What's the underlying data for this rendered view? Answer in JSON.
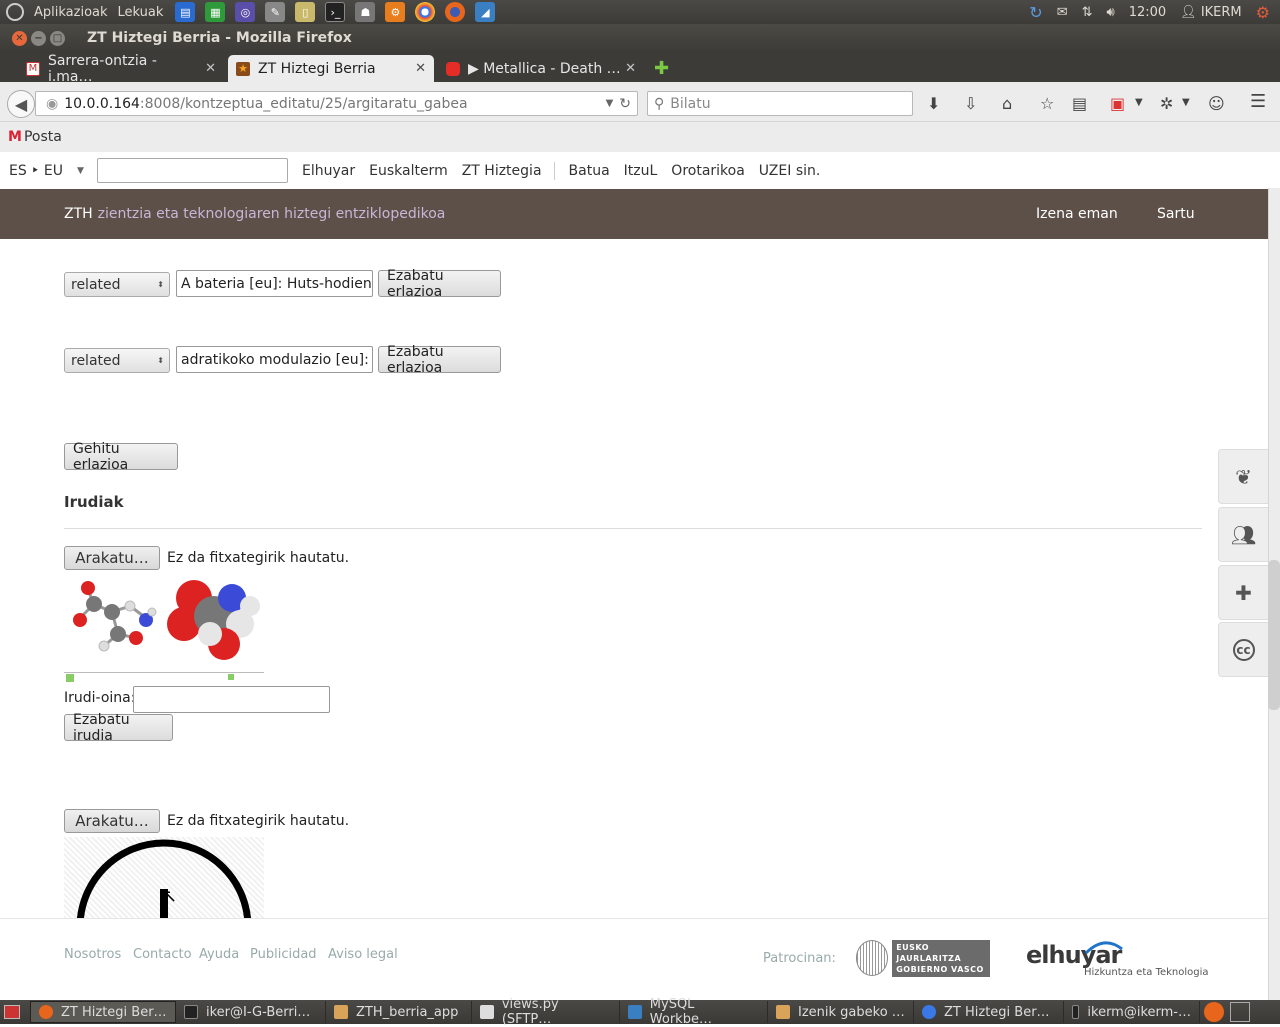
{
  "top_panel": {
    "menu_apps": "Aplikazioak",
    "menu_places": "Lekuak",
    "clock": "12:00",
    "user": "IKERM"
  },
  "window": {
    "title": "ZT Hiztegi Berria - Mozilla Firefox"
  },
  "tabs": [
    {
      "label": "Sarrera-ontzia - i.ma…"
    },
    {
      "label": "ZT Hiztegi Berria"
    },
    {
      "label": "▶ Metallica - Death …"
    }
  ],
  "nav": {
    "url_host": "10.0.0.164",
    "url_rest": ":8008/kontzeptua_editatu/25/argitaratu_gabea",
    "search_placeholder": "Bilatu"
  },
  "bookmarks": [
    {
      "label": "Posta"
    }
  ],
  "langbar": {
    "lang_pair": "ES ‣ EU",
    "links": [
      "Elhuyar",
      "Euskalterm",
      "ZT Hiztegia"
    ],
    "links2": [
      "Batua",
      "ItzuL",
      "Orotarikoa",
      "UZEI sin."
    ]
  },
  "sitebar": {
    "brand": "ZTH",
    "tagline": "zientzia eta teknologiaren hiztegi entziklopedikoa",
    "register": "Izena eman",
    "login": "Sartu"
  },
  "relations": [
    {
      "type": "related",
      "value": "A bateria [eu]: Huts-hodien har",
      "delete": "Ezabatu erlazioa"
    },
    {
      "type": "related",
      "value": "adratikoko modulazio [eu]: Se",
      "delete": "Ezabatu erlazioa"
    }
  ],
  "add_relation": "Gehitu erlazioa",
  "images_section": {
    "heading": "Irudiak",
    "browse": "Arakatu…",
    "no_file": "Ez da fitxategirik hautatu.",
    "caption_label": "Irudi-oina:",
    "caption_value": "",
    "delete_image": "Ezabatu irudia"
  },
  "footer": {
    "links": [
      "Nosotros",
      "Contacto",
      "Ayuda",
      "Publicidad",
      "Aviso legal"
    ],
    "sponsor_label": "Patrocinan:",
    "gov_line1": "EUSKO JAURLARITZA",
    "gov_line2": "GOBIERNO VASCO",
    "elhuyar": "elhuyar",
    "elhuyar_sub": "Hizkuntza eta Teknologia"
  },
  "taskbar": [
    {
      "label": "ZT Hiztegi Ber…"
    },
    {
      "label": "iker@I-G-Berri…"
    },
    {
      "label": "ZTH_berria_app"
    },
    {
      "label": "views.py (SFTP…"
    },
    {
      "label": "MySQL Workbe…"
    },
    {
      "label": "Izenik gabeko …"
    },
    {
      "label": "ZT Hiztegi Ber…"
    },
    {
      "label": "ikerm@ikerm-…"
    }
  ]
}
